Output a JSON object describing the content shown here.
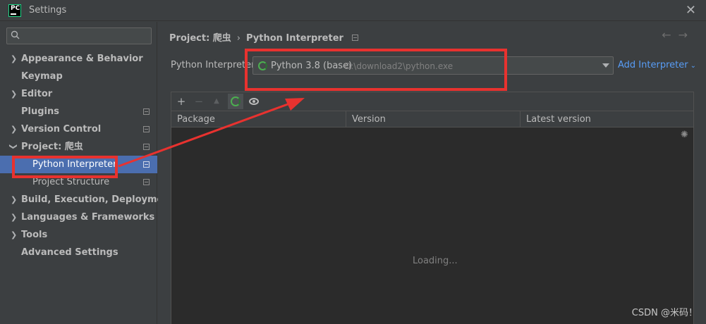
{
  "window": {
    "title": "Settings",
    "app_logo_text": "PC"
  },
  "sidebar": {
    "search_placeholder": "",
    "items": [
      {
        "label": "Appearance & Behavior",
        "expandable": true,
        "expanded": false
      },
      {
        "label": "Keymap",
        "expandable": false
      },
      {
        "label": "Editor",
        "expandable": true,
        "expanded": false
      },
      {
        "label": "Plugins",
        "expandable": false,
        "badge": true
      },
      {
        "label": "Version Control",
        "expandable": true,
        "expanded": false,
        "badge": true
      },
      {
        "label": "Project: 爬虫",
        "expandable": true,
        "expanded": true,
        "badge": true
      },
      {
        "label": "Python Interpreter",
        "child": true,
        "selected": true,
        "badge": true
      },
      {
        "label": "Project Structure",
        "child": true,
        "badge": true
      },
      {
        "label": "Build, Execution, Deployment",
        "expandable": true,
        "expanded": false
      },
      {
        "label": "Languages & Frameworks",
        "expandable": true,
        "expanded": false
      },
      {
        "label": "Tools",
        "expandable": true,
        "expanded": false
      },
      {
        "label": "Advanced Settings",
        "expandable": false
      }
    ]
  },
  "main": {
    "breadcrumb": {
      "project": "Project: 爬虫",
      "separator": "›",
      "page": "Python Interpreter"
    },
    "interpreter": {
      "label": "Python Interpreter:",
      "name": "Python 3.8 (base)",
      "path": "D:\\download2\\python.exe",
      "add_label": "Add Interpreter"
    },
    "toolbar": {
      "add": "+",
      "remove": "−",
      "up": "▲"
    },
    "table": {
      "columns": [
        "Package",
        "Version",
        "Latest version"
      ],
      "rows": [],
      "loading_text": "Loading..."
    }
  },
  "watermark": "CSDN @米码！",
  "colors": {
    "accent": "#4b6eaf",
    "link": "#589df6",
    "annotation": "#e8322f",
    "spinner": "#4caf50"
  }
}
